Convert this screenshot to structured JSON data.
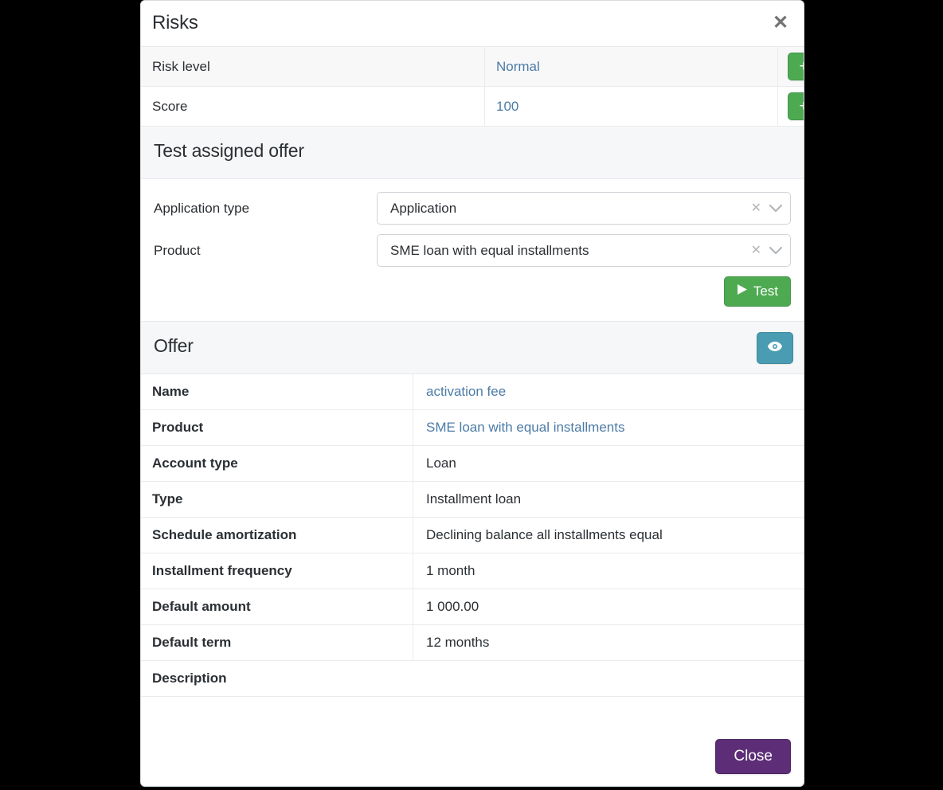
{
  "modal": {
    "title": "Risks",
    "close_icon": "close-icon",
    "footer": {
      "close_label": "Close"
    }
  },
  "risks": {
    "rows": [
      {
        "key": "Risk level",
        "value": "Normal",
        "action": "+"
      },
      {
        "key": "Score",
        "value": "100",
        "action": "+"
      }
    ]
  },
  "test_section": {
    "title": "Test assigned offer",
    "fields": [
      {
        "label": "Application type",
        "value": "Application",
        "clear_icon": "✕",
        "caret_icon": "⌄"
      },
      {
        "label": "Product",
        "value": "SME loan with equal installments",
        "clear_icon": "✕",
        "caret_icon": "⌄"
      }
    ],
    "test_button": {
      "label": "Test",
      "icon": "play-icon"
    }
  },
  "offer_section": {
    "title": "Offer",
    "preview_button_icon": "eye-icon",
    "rows": [
      {
        "key": "Name",
        "value": "activation fee",
        "link": true
      },
      {
        "key": "Product",
        "value": "SME loan with equal installments",
        "link": true
      },
      {
        "key": "Account type",
        "value": "Loan",
        "link": false
      },
      {
        "key": "Type",
        "value": "Installment loan",
        "link": false
      },
      {
        "key": "Schedule amortization",
        "value": "Declining balance all installments equal",
        "link": false
      },
      {
        "key": "Installment frequency",
        "value": "1 month",
        "link": false
      },
      {
        "key": "Default amount",
        "value": "1 000.00",
        "link": false
      },
      {
        "key": "Default term",
        "value": "12 months",
        "link": false
      },
      {
        "key": "Description",
        "value": "",
        "link": false
      }
    ]
  },
  "colors": {
    "add_button": "#4eaa50",
    "test_button": "#4eaa50",
    "preview_button": "#4a9cb2",
    "close_button": "#5d2e77",
    "link": "#4c7ba6",
    "section_bar": "#f6f7f8",
    "backdrop": "#000000"
  }
}
